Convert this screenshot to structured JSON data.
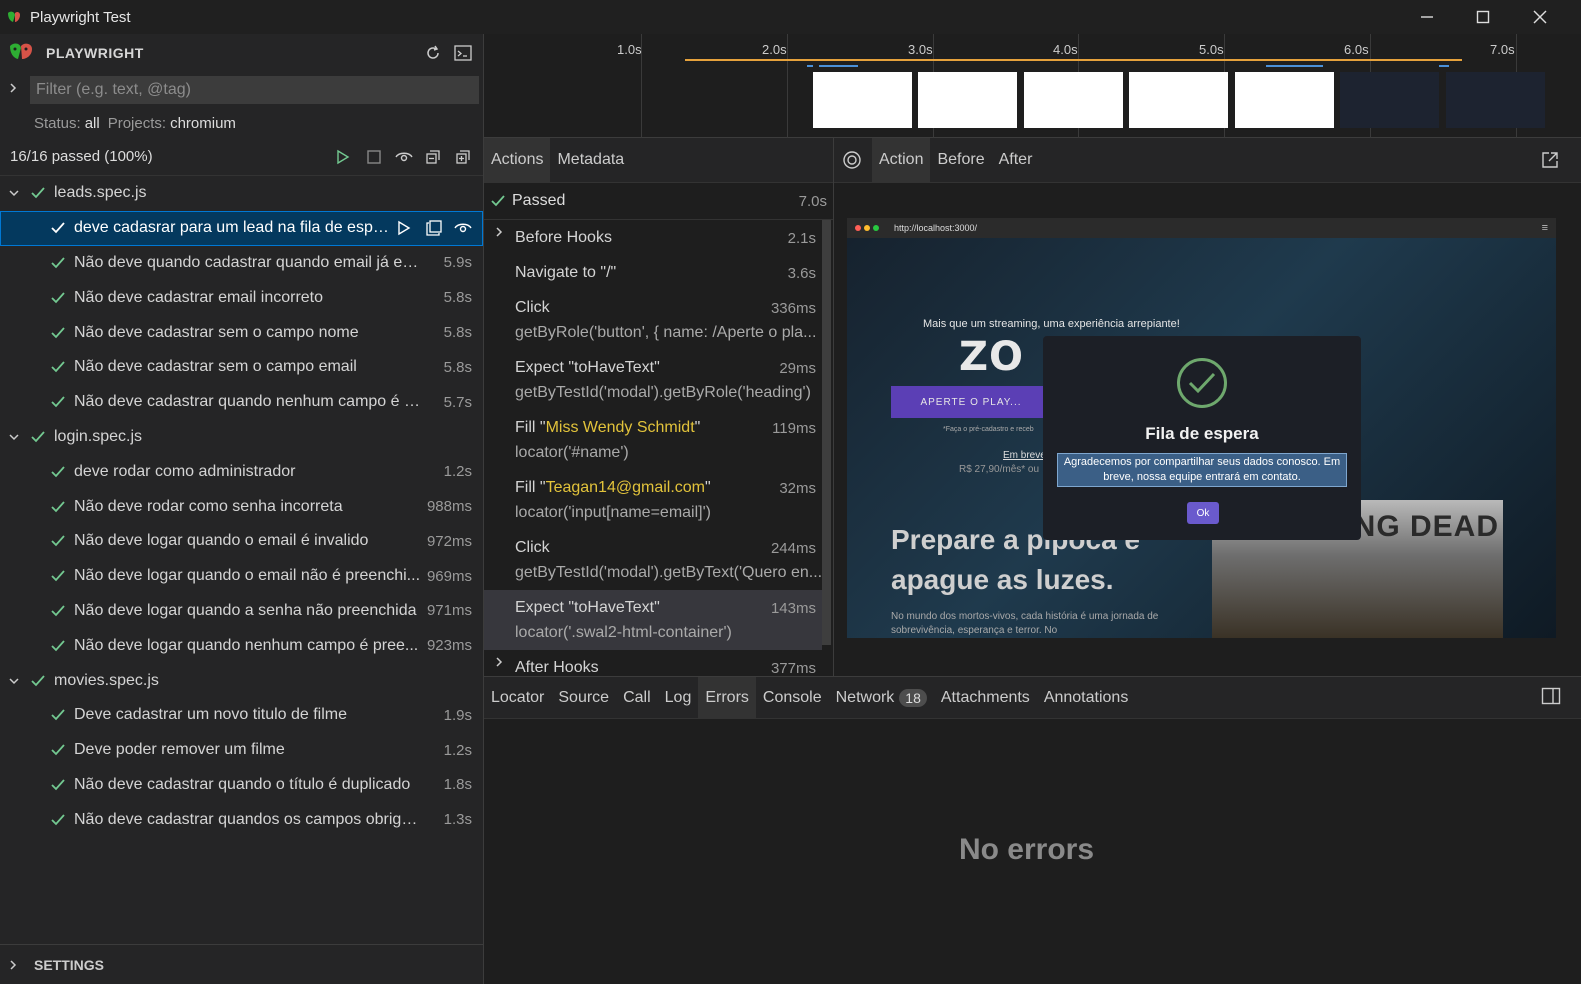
{
  "window": {
    "title": "Playwright Test"
  },
  "sidebar": {
    "brand": "PLAYWRIGHT",
    "filter_placeholder": "Filter (e.g. text, @tag)",
    "status_label": "Status:",
    "status_value": "all",
    "projects_label": "Projects:",
    "projects_value": "chromium",
    "summary": "16/16 passed (100%)",
    "files": [
      {
        "name": "leads.spec.js",
        "tests": [
          {
            "title": "deve cadasrar para um lead na fila de espe...",
            "duration": ""
          },
          {
            "title": "Não deve quando cadastrar quando email já existe",
            "duration": "5.9s"
          },
          {
            "title": "Não deve cadastrar email incorreto",
            "duration": "5.8s"
          },
          {
            "title": "Não deve cadastrar sem o campo nome",
            "duration": "5.8s"
          },
          {
            "title": "Não deve cadastrar sem o campo email",
            "duration": "5.8s"
          },
          {
            "title": "Não deve cadastrar quando nenhum campo é pre...",
            "duration": "5.7s"
          }
        ]
      },
      {
        "name": "login.spec.js",
        "tests": [
          {
            "title": "deve rodar como administrador",
            "duration": "1.2s"
          },
          {
            "title": "Não deve rodar como senha incorreta",
            "duration": "988ms"
          },
          {
            "title": "Não deve logar quando o email é invalido",
            "duration": "972ms"
          },
          {
            "title": "Não deve logar quando o email não é preenchi...",
            "duration": "969ms"
          },
          {
            "title": "Não deve logar quando a senha não preenchida",
            "duration": "971ms"
          },
          {
            "title": "Não deve logar quando nenhum campo é pree...",
            "duration": "923ms"
          }
        ]
      },
      {
        "name": "movies.spec.js",
        "tests": [
          {
            "title": "Deve cadastrar um novo titulo de filme",
            "duration": "1.9s"
          },
          {
            "title": "Deve poder remover um filme",
            "duration": "1.2s"
          },
          {
            "title": "Não deve cadastrar quando o título é duplicado",
            "duration": "1.8s"
          },
          {
            "title": "Não deve cadastrar quandos os campos obrigató...",
            "duration": "1.3s"
          }
        ]
      }
    ],
    "settings_label": "SETTINGS"
  },
  "timeline": {
    "ticks": [
      "1.0s",
      "2.0s",
      "3.0s",
      "4.0s",
      "5.0s",
      "6.0s",
      "7.0s"
    ]
  },
  "actions_panel": {
    "tabs": [
      "Actions",
      "Metadata"
    ],
    "passed_label": "Passed",
    "passed_duration": "7.0s",
    "actions": [
      {
        "line1": "Before Hooks",
        "line2": "",
        "duration": "2.1s",
        "expandable": true
      },
      {
        "line1": "Navigate to \"/\"",
        "line2": "",
        "duration": "3.6s",
        "expandable": false
      },
      {
        "line1": "Click",
        "line2": "getByRole('button', { name: /Aperte o pla...",
        "duration": "336ms",
        "expandable": false
      },
      {
        "line1": "Expect \"toHaveText\"",
        "line2": "getByTestId('modal').getByRole('heading')",
        "duration": "29ms",
        "expandable": false
      },
      {
        "line1_prefix": "Fill \"",
        "line1_value": "Miss Wendy Schmidt",
        "line1_suffix": "\"",
        "line2": "locator('#name')",
        "duration": "119ms",
        "expandable": false
      },
      {
        "line1_prefix": "Fill \"",
        "line1_value": "Teagan14@gmail.com",
        "line1_suffix": "\"",
        "line2": "locator('input[name=email]')",
        "duration": "32ms",
        "expandable": false
      },
      {
        "line1": "Click",
        "line2": "getByTestId('modal').getByText('Quero en...",
        "duration": "244ms",
        "expandable": false
      },
      {
        "line1": "Expect \"toHaveText\"",
        "line2": "locator('.swal2-html-container')",
        "duration": "143ms",
        "expandable": false
      },
      {
        "line1": "After Hooks",
        "line2": "",
        "duration": "377ms",
        "expandable": true
      }
    ]
  },
  "snapshot": {
    "tabs": [
      "Action",
      "Before",
      "After"
    ],
    "url": "http://localhost:3000/",
    "page": {
      "tagline": "Mais que um streaming, uma experiência arrepiante!",
      "logo": "ZO",
      "cta": "APERTE O PLAY...",
      "small": "*Faça o pré-cadastro e receb",
      "em_breve": "Em breve",
      "price": "R$ 27,90/mês* ou",
      "heading": "Prepare a pipoca e apague as luzes.",
      "paragraph": "No mundo dos mortos-vivos, cada história é uma jornada de sobrevivência, esperança e terror. No",
      "poster_title": "WALKING DEAD"
    },
    "modal": {
      "title": "Fila de espera",
      "text": "Agradecemos por compartilhar seus dados conosco. Em breve, nossa equipe entrará em contato.",
      "ok": "Ok"
    }
  },
  "bottom_panel": {
    "tabs": [
      "Locator",
      "Source",
      "Call",
      "Log",
      "Errors",
      "Console",
      "Network",
      "Attachments",
      "Annotations"
    ],
    "network_count": "18",
    "empty_message": "No errors"
  },
  "colors": {
    "accent": "#0078d4",
    "pass": "#73c991",
    "highlight": "#e2c33b"
  }
}
